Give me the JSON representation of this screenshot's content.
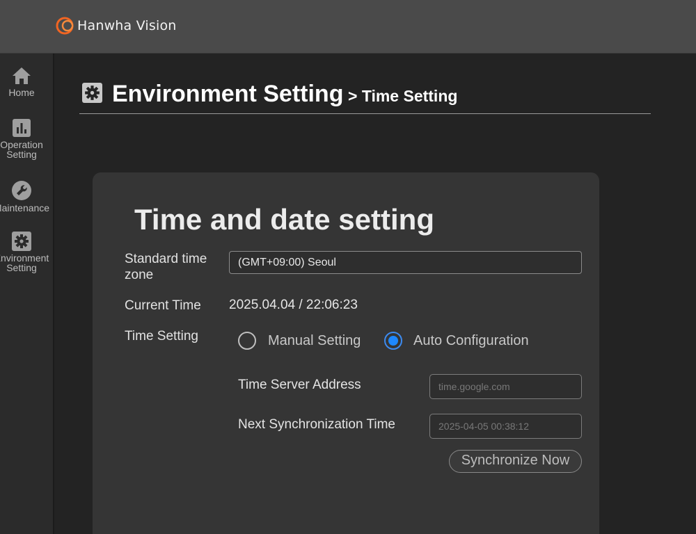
{
  "brand": {
    "name": "Hanwha Vision",
    "accent": "#f26522"
  },
  "sidebar": {
    "items": [
      {
        "label": "Home",
        "icon": "home-icon"
      },
      {
        "label": "Operation\nSetting",
        "icon": "chart-icon"
      },
      {
        "label": "Maintenance",
        "icon": "wrench-icon"
      },
      {
        "label": "Environment\nSetting",
        "icon": "gear-icon"
      }
    ]
  },
  "header": {
    "title": "Environment Setting",
    "subtitle": "> Time Setting",
    "icon": "gear-icon"
  },
  "card": {
    "title": "Time and date setting",
    "timezone": {
      "label": "Standard time\nzone",
      "value": "(GMT+09:00) Seoul"
    },
    "current_time": {
      "label": "Current Time",
      "value": "2025.04.04 / 22:06:23"
    },
    "time_setting": {
      "label": "Time Setting",
      "options": [
        {
          "label": "Manual Setting",
          "checked": false
        },
        {
          "label": "Auto Configuration",
          "checked": true
        }
      ]
    },
    "server": {
      "label": "Time Server Address",
      "placeholder": "time.google.com"
    },
    "next_sync": {
      "label": "Next Synchronization Time",
      "placeholder": "2025-04-05 00:38:12"
    },
    "sync_button": "Synchronize Now"
  },
  "colors": {
    "radio_selected": "#1e88ff",
    "background": "#232323",
    "card": "#353535"
  }
}
